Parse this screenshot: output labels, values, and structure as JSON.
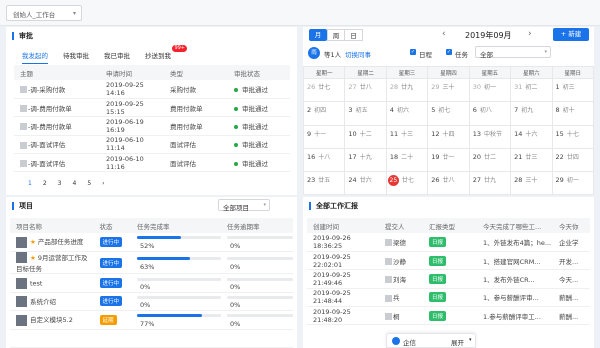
{
  "workspace": {
    "label": "创始人_工作台"
  },
  "approval": {
    "title": "审批",
    "tabs": [
      "我发起的",
      "待我审批",
      "我已审批",
      "抄送到我"
    ],
    "badge": "99+",
    "columns": [
      "主题",
      "申请时间",
      "类型",
      "审批状态"
    ],
    "rows": [
      {
        "subject": "-调-采购付款",
        "time": "2019-09-25 14:16",
        "type": "采购付款",
        "status": "审批通过"
      },
      {
        "subject": "-调-费用付款单",
        "time": "2019-09-25 15:15",
        "type": "费用付款单",
        "status": "审批通过"
      },
      {
        "subject": "-调-费用付款单",
        "time": "2019-06-19 16:19",
        "type": "费用付款单",
        "status": "审批通过"
      },
      {
        "subject": "-调-面试评估",
        "time": "2019-06-10 11:14",
        "type": "面试评估",
        "status": "审批通过"
      },
      {
        "subject": "-调-面试评估",
        "time": "2019-06-10 11:16",
        "type": "面试评估",
        "status": "审批通过"
      }
    ],
    "pages": [
      "1",
      "2",
      "3",
      "4",
      "5"
    ],
    "status_color": "#27a745"
  },
  "calendar": {
    "views": [
      "月",
      "周",
      "日"
    ],
    "month": "2019年09月",
    "new_label": "+ 新建",
    "owner": "等1人",
    "switch_label": "切换同事",
    "owner_avatar": "雨",
    "checks": [
      "日程",
      "任务"
    ],
    "filter": "全部",
    "weekdays": [
      "星期一",
      "星期二",
      "星期三",
      "星期四",
      "星期五",
      "星期六",
      "星期日"
    ],
    "weeks": [
      [
        [
          "26",
          "廿七",
          true
        ],
        [
          "27",
          "廿八",
          true
        ],
        [
          "28",
          "廿九",
          true
        ],
        [
          "29",
          "三十",
          true
        ],
        [
          "30",
          "初一",
          true
        ],
        [
          "31",
          "初二",
          true
        ],
        [
          "1",
          "初三",
          false
        ]
      ],
      [
        [
          "2",
          "初四",
          false
        ],
        [
          "3",
          "初五",
          false
        ],
        [
          "4",
          "初六",
          false
        ],
        [
          "5",
          "初七",
          false
        ],
        [
          "6",
          "初八",
          false
        ],
        [
          "7",
          "初九",
          false
        ],
        [
          "8",
          "初十",
          false
        ]
      ],
      [
        [
          "9",
          "十一",
          false
        ],
        [
          "10",
          "十二",
          false
        ],
        [
          "11",
          "十三",
          false
        ],
        [
          "12",
          "十四",
          false
        ],
        [
          "13",
          "中秋节",
          false
        ],
        [
          "14",
          "十六",
          false
        ],
        [
          "15",
          "十七",
          false
        ]
      ],
      [
        [
          "16",
          "十八",
          false
        ],
        [
          "17",
          "十九",
          false
        ],
        [
          "18",
          "二十",
          false
        ],
        [
          "19",
          "廿一",
          false
        ],
        [
          "20",
          "廿二",
          false
        ],
        [
          "21",
          "廿三",
          false
        ],
        [
          "22",
          "廿四",
          false
        ]
      ],
      [
        [
          "23",
          "廿五",
          false
        ],
        [
          "24",
          "廿六",
          false
        ],
        [
          "25",
          "廿七",
          false
        ],
        [
          "26",
          "廿八",
          false
        ],
        [
          "27",
          "廿九",
          false
        ],
        [
          "28",
          "三十",
          false
        ],
        [
          "29",
          "初一",
          false
        ]
      ]
    ],
    "today": "25",
    "accent": "#1a73e8",
    "today_color": "#e53935"
  },
  "projects": {
    "title": "项目",
    "filter": "全部项目",
    "columns": [
      "项目名称",
      "状态",
      "任务完成率",
      "任务逾期率"
    ],
    "rows": [
      {
        "name": "产品部任务进度",
        "star": true,
        "status": "进行中",
        "status_color": "#1a73e8",
        "done": 52,
        "done_label": "52%",
        "overdue": 0,
        "overdue_label": "0%"
      },
      {
        "name": "9月运营部工作及目标任务",
        "star": true,
        "status": "进行中",
        "status_color": "#1a73e8",
        "done": 63,
        "done_label": "63%",
        "overdue": 0,
        "overdue_label": "0%"
      },
      {
        "name": "test",
        "star": false,
        "status": "进行中",
        "status_color": "#1a73e8",
        "done": 0,
        "done_label": "0%",
        "overdue": 0,
        "overdue_label": "0%"
      },
      {
        "name": "系统介绍",
        "star": false,
        "status": "进行中",
        "status_color": "#1a73e8",
        "done": 0,
        "done_label": "0%",
        "overdue": 0,
        "overdue_label": "0%"
      },
      {
        "name": "自定义模块5.2",
        "star": false,
        "status": "延期",
        "status_color": "#f59d00",
        "done": 77,
        "done_label": "77%",
        "overdue": 0,
        "overdue_label": "0%"
      },
      {
        "name": "",
        "star": false,
        "status": "",
        "status_color": "#1a73e8",
        "done": 0,
        "done_label": "",
        "overdue": 0,
        "overdue_label": ""
      }
    ]
  },
  "reports": {
    "title": "全部工作汇报",
    "columns": [
      "创建时间",
      "提交人",
      "汇报类型",
      "今天完成了哪些工...",
      "今天你"
    ],
    "rows": [
      {
        "time": "2019-09-26 18:36:25",
        "user": "梁德",
        "type": "日报",
        "done": "1、外链发布4篇；he...",
        "extra": "企业学"
      },
      {
        "time": "2019-09-25 22:02:01",
        "user": "沙静",
        "type": "日报",
        "done": "1、搭建官网CRM...",
        "extra": "开发..."
      },
      {
        "time": "2019-09-25 21:49:46",
        "user": "刘海",
        "type": "日报",
        "done": "1、发布外链CR...",
        "extra": "今天..."
      },
      {
        "time": "2019-09-25 21:48:44",
        "user": "兵",
        "type": "日报",
        "done": "1、参与薪酬评审...",
        "extra": "薪酬..."
      },
      {
        "time": "2019-09-25 21:48:20",
        "user": "桐",
        "type": "日报",
        "done": "1.参与薪酬评审工...",
        "extra": "薪酬..."
      }
    ],
    "tag_color": "#2ebd6b"
  },
  "floating": {
    "name": "企信",
    "action": "展开"
  }
}
